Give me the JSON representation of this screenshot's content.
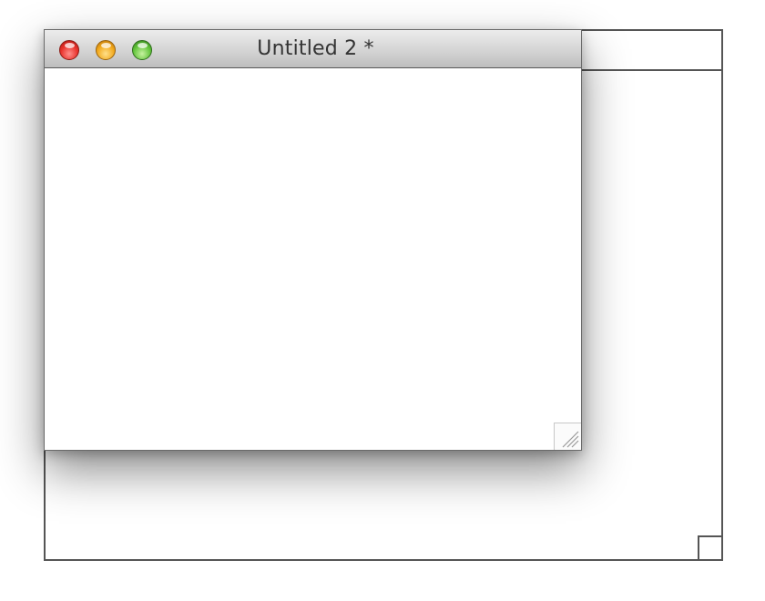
{
  "window": {
    "title": "Untitled 2 *",
    "controls": {
      "close": "close-icon",
      "minimize": "minimize-icon",
      "zoom": "zoom-icon"
    },
    "resize_handle": "resize-grip-icon"
  },
  "background_window": {
    "outline": true,
    "resize_handle": "resize-box-icon"
  },
  "colors": {
    "close": "#e8302a",
    "minimize": "#f2a81b",
    "zoom": "#62c43b",
    "outline": "#555555"
  }
}
